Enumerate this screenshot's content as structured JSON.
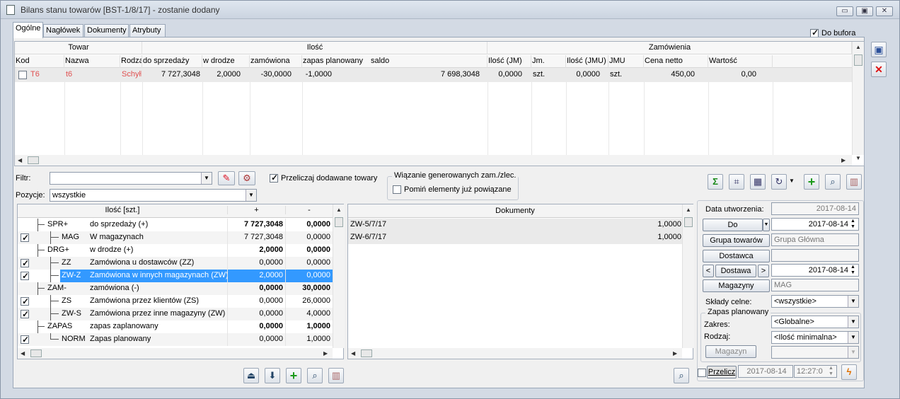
{
  "window": {
    "title": "Bilans stanu towarów [BST-1/8/17] - zostanie dodany",
    "min": "▭",
    "max": "▣",
    "close": "✕"
  },
  "tabs": [
    "Ogólne",
    "Nagłówek",
    "Dokumenty",
    "Atrybuty"
  ],
  "do_bufora": "Do bufora",
  "grid": {
    "group_headers": {
      "towar": "Towar",
      "ilosc": "Ilość",
      "zamowienia": "Zamówienia"
    },
    "columns": [
      "Kod",
      "Nazwa",
      "Rodza",
      "do sprzedaży",
      "w drodze",
      "zamówiona",
      "zapas planowany",
      "saldo",
      "Ilość (JM)",
      "Jm.",
      "Ilość (JMU)",
      "JMU",
      "Cena netto",
      "Wartość"
    ],
    "row": {
      "kod": "T6",
      "nazwa": "t6",
      "rodzaj": "Schyłk",
      "do_sprzedazy": "7 727,3048",
      "w_drodze": "2,0000",
      "zamowiona": "-30,0000",
      "zapas": "-1,0000",
      "saldo": "7 698,3048",
      "ilosc_jm": "0,0000",
      "jm": "szt.",
      "ilosc_jmu": "0,0000",
      "jmu": "szt.",
      "cena": "450,00",
      "wartosc": "0,00"
    }
  },
  "filter": {
    "label": "Filtr:",
    "value": ""
  },
  "pozycje": {
    "label": "Pozycje:",
    "value": "wszystkie"
  },
  "przeliczaj": "Przeliczaj dodawane towary",
  "wiazanie": {
    "title": "Wiązanie generowanych zam./zlec.",
    "pomin": "Pomiń elementy już powiązane"
  },
  "tree": {
    "headers": [
      "Ilość [szt.]",
      "+",
      "-"
    ],
    "rows": [
      {
        "code": "SPR+",
        "name": "do sprzedaży (+)",
        "plus": "7 727,3048",
        "minus": "0,0000",
        "bold": true
      },
      {
        "code": "MAG",
        "name": "W magazynach",
        "plus": "7 727,3048",
        "minus": "0,0000",
        "checked": true
      },
      {
        "code": "DRG+",
        "name": "w drodze (+)",
        "plus": "2,0000",
        "minus": "0,0000",
        "bold": true
      },
      {
        "code": "ZZ",
        "name": "Zamówiona u dostawców (ZZ)",
        "plus": "0,0000",
        "minus": "0,0000",
        "checked": true
      },
      {
        "code": "ZW-Z",
        "name": "Zamówiona w innych magazynach (ZW)",
        "plus": "2,0000",
        "minus": "0,0000",
        "checked": true,
        "selected": true
      },
      {
        "code": "ZAM-",
        "name": "zamówiona (-)",
        "plus": "0,0000",
        "minus": "30,0000",
        "bold": true
      },
      {
        "code": "ZS",
        "name": "Zamówiona przez klientów (ZS)",
        "plus": "0,0000",
        "minus": "26,0000",
        "checked": true
      },
      {
        "code": "ZW-S",
        "name": "Zamówiona przez inne magazyny (ZW)",
        "plus": "0,0000",
        "minus": "4,0000",
        "checked": true
      },
      {
        "code": "ZAPAS",
        "name": "zapas zaplanowany",
        "plus": "0,0000",
        "minus": "1,0000",
        "bold": true
      },
      {
        "code": "NORM",
        "name": "Zapas planowany",
        "plus": "0,0000",
        "minus": "1,0000",
        "checked": true
      }
    ]
  },
  "docs": {
    "header": "Dokumenty",
    "rows": [
      {
        "doc": "ZW-5/7/17",
        "val": "1,0000"
      },
      {
        "doc": "ZW-6/7/17",
        "val": "1,0000"
      }
    ]
  },
  "right": {
    "data_utworzenia_label": "Data utworzenia:",
    "data_utworzenia": "2017-08-14",
    "do_btn": "Do",
    "do_date": "2017-08-14",
    "grupa_btn": "Grupa towarów",
    "grupa_val": "Grupa Główna",
    "dostawca_btn": "Dostawca",
    "dostawca_val": "",
    "dostawa_btn": "Dostawa",
    "dostawa_date": "2017-08-14",
    "magazyny_btn": "Magazyny",
    "magazyny_val": "MAG",
    "sklady_label": "Składy celne:",
    "sklady_val": "<wszystkie>",
    "zapas_group": "Zapas planowany",
    "zakres_label": "Zakres:",
    "zakres_val": "<Globalne>",
    "rodzaj_label": "Rodzaj:",
    "rodzaj_val": "<Ilość minimalna>",
    "magazyn_btn": "Magazyn",
    "magazyn_val": "",
    "przelicz": "Przelicz",
    "przelicz_date": "2017-08-14",
    "przelicz_time": "12:27:0"
  }
}
